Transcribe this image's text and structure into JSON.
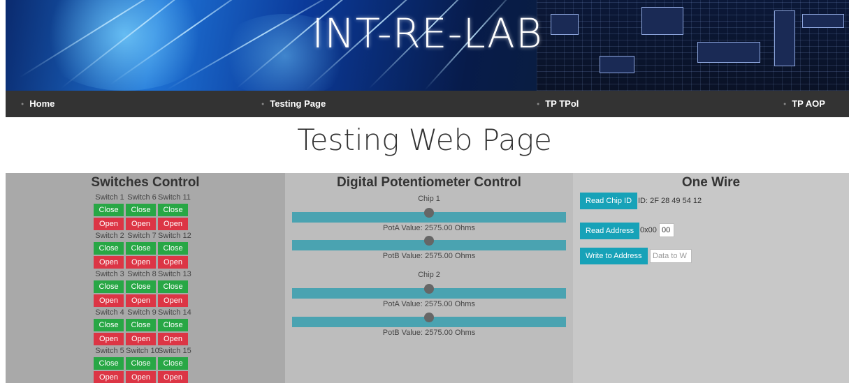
{
  "banner": {
    "title": "INT-RE-LAB"
  },
  "nav": {
    "items": [
      "Home",
      "Testing Page",
      "TP TPol",
      "TP AOP"
    ]
  },
  "page": {
    "title": "Testing Web Page"
  },
  "switches": {
    "title": "Switches Control",
    "close_label": "Close",
    "open_label": "Open",
    "groups": [
      [
        "Switch 1",
        "Switch 6",
        "Switch 11"
      ],
      [
        "Switch 2",
        "Switch 7",
        "Switch 12"
      ],
      [
        "Switch 3",
        "Switch 8",
        "Switch 13"
      ],
      [
        "Switch 4",
        "Switch 9",
        "Switch 14"
      ],
      [
        "Switch 5",
        "Switch 10",
        "Switch 15"
      ]
    ]
  },
  "pot": {
    "title": "Digital Potentiometer Control",
    "chips": [
      {
        "label": "Chip 1",
        "pots": [
          {
            "value_text": "PotA Value: 2575.00 Ohms",
            "level": 0.5
          },
          {
            "value_text": "PotB Value: 2575.00 Ohms",
            "level": 0.5
          }
        ]
      },
      {
        "label": "Chip 2",
        "pots": [
          {
            "value_text": "PotA Value: 2575.00 Ohms",
            "level": 0.5
          },
          {
            "value_text": "PotB Value: 2575.00 Ohms",
            "level": 0.5
          }
        ]
      }
    ]
  },
  "one_wire": {
    "title": "One Wire",
    "read_chip_id_label": "Read Chip ID",
    "chip_id_text": "ID: 2F 28 49 54 12",
    "read_address_label": "Read Address",
    "address_prefix": "0x00",
    "address_value": "00",
    "write_address_label": "Write to Address",
    "write_placeholder": "Data to W"
  },
  "colors": {
    "close_button": "#28a745",
    "open_button": "#dc3545",
    "slider_track": "#4aa3b1",
    "info_button": "#17a2b8",
    "nav_background": "#333333"
  }
}
